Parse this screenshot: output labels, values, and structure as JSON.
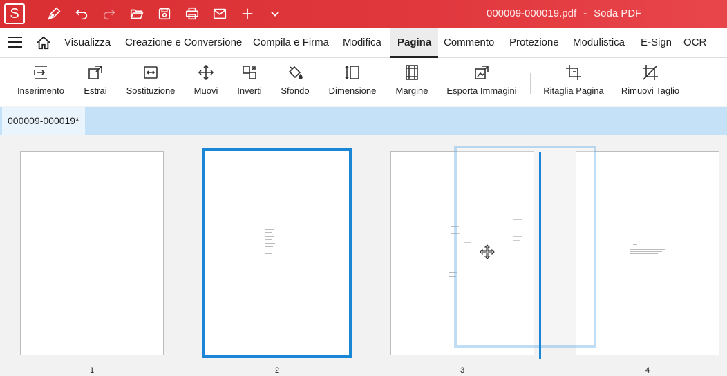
{
  "app": {
    "logo_letter": "S",
    "document_name": "000009-000019.pdf",
    "separator": "-",
    "app_name": "Soda PDF",
    "accent_color": "#e0383d",
    "selection_color": "#1a86d6"
  },
  "quick_access": [
    {
      "icon": "pen-icon"
    },
    {
      "icon": "undo-icon"
    },
    {
      "icon": "redo-icon"
    },
    {
      "icon": "open-folder-icon"
    },
    {
      "icon": "save-icon"
    },
    {
      "icon": "print-icon"
    },
    {
      "icon": "mail-icon"
    },
    {
      "icon": "plus-icon"
    },
    {
      "icon": "chevron-down-icon"
    }
  ],
  "menu": {
    "items": [
      "Visualizza",
      "Creazione e Conversione",
      "Compila e Firma",
      "Modifica",
      "Pagina",
      "Commento",
      "Protezione",
      "Modulistica",
      "E-Sign",
      "OCR"
    ],
    "active": "Pagina"
  },
  "ribbon": {
    "buttons": [
      {
        "label": "Inserimento",
        "icon": "insert-icon"
      },
      {
        "label": "Estrai",
        "icon": "extract-icon"
      },
      {
        "label": "Sostituzione",
        "icon": "replace-icon"
      },
      {
        "label": "Muovi",
        "icon": "move-icon"
      },
      {
        "label": "Inverti",
        "icon": "invert-icon"
      },
      {
        "label": "Sfondo",
        "icon": "paint-bucket-icon"
      },
      {
        "label": "Dimensione",
        "icon": "dimension-icon"
      },
      {
        "label": "Margine",
        "icon": "margin-icon"
      },
      {
        "label": "Esporta Immagini",
        "icon": "export-images-icon"
      },
      {
        "label": "Ritaglia Pagina",
        "icon": "crop-icon"
      },
      {
        "label": "Rimuovi Taglio",
        "icon": "remove-crop-icon"
      }
    ]
  },
  "tabs": [
    {
      "label": "000009-000019*"
    }
  ],
  "pages": [
    {
      "number": "1",
      "selected": false
    },
    {
      "number": "2",
      "selected": true
    },
    {
      "number": "3",
      "selected": false
    },
    {
      "number": "4",
      "selected": false
    }
  ]
}
